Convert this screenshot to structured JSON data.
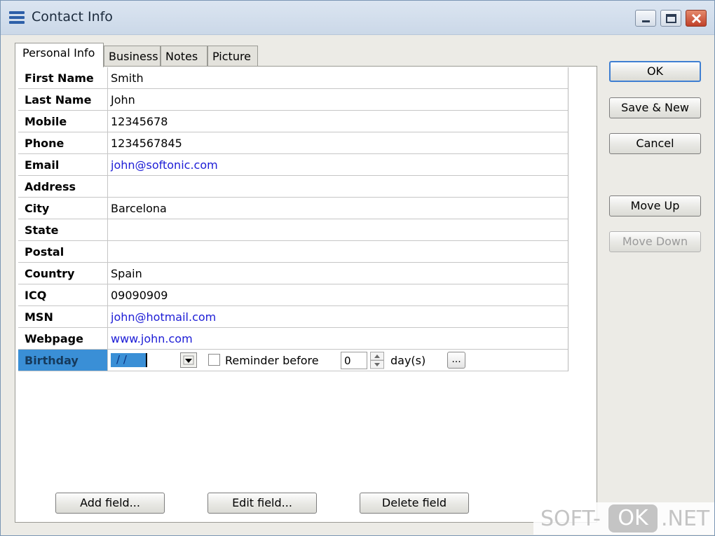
{
  "window": {
    "title": "Contact Info"
  },
  "tabs": [
    {
      "label": "Personal Info",
      "active": true
    },
    {
      "label": "Business",
      "active": false
    },
    {
      "label": "Notes",
      "active": false
    },
    {
      "label": "Picture",
      "active": false
    }
  ],
  "fields": [
    {
      "label": "First Name",
      "value": "Smith"
    },
    {
      "label": "Last Name",
      "value": "John"
    },
    {
      "label": "Mobile",
      "value": "12345678"
    },
    {
      "label": "Phone",
      "value": "1234567845"
    },
    {
      "label": "Email",
      "value": "john@softonic.com",
      "link": true
    },
    {
      "label": "Address",
      "value": ""
    },
    {
      "label": "City",
      "value": "Barcelona"
    },
    {
      "label": "State",
      "value": ""
    },
    {
      "label": "Postal",
      "value": ""
    },
    {
      "label": "Country",
      "value": "Spain"
    },
    {
      "label": "ICQ",
      "value": "09090909"
    },
    {
      "label": "MSN",
      "value": "john@hotmail.com",
      "link": true
    },
    {
      "label": "Webpage",
      "value": "www.john.com",
      "link": true
    }
  ],
  "birthday": {
    "label": "Birthday",
    "date_value": "/ /",
    "reminder_label": "Reminder before",
    "reminder_checked": false,
    "reminder_days": "0",
    "days_label": "day(s)",
    "more_label": "..."
  },
  "side_buttons": {
    "ok": "OK",
    "save_new": "Save & New",
    "cancel": "Cancel",
    "move_up": "Move Up",
    "move_down": "Move Down"
  },
  "bottom_buttons": {
    "add": "Add field...",
    "edit": "Edit field...",
    "delete": "Delete field"
  },
  "watermark": {
    "left": "SOFT-",
    "box": "OK",
    "right": ".NET"
  },
  "colors": {
    "selection": "#3a8fd6",
    "link": "#1c1cd6",
    "default_button_border": "#3f7fd2"
  }
}
